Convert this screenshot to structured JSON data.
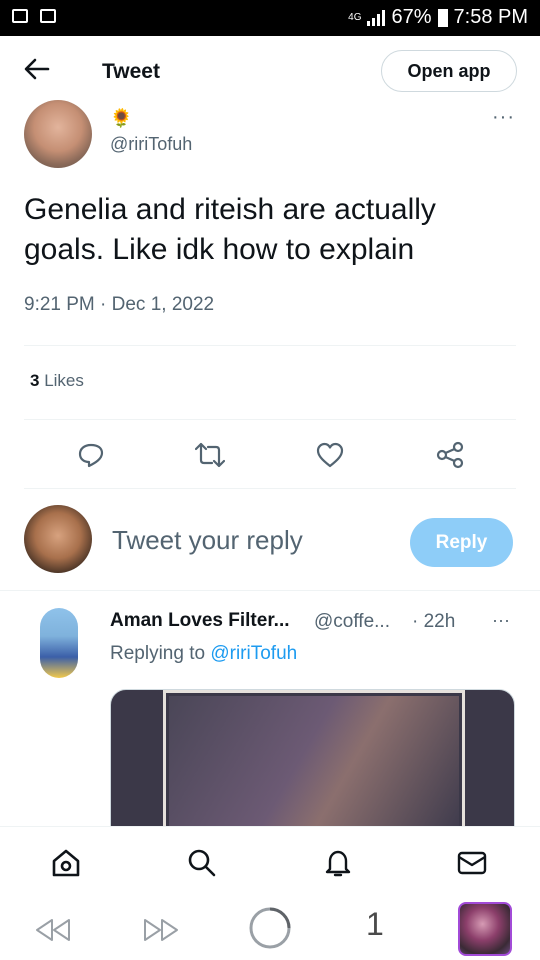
{
  "status_bar": {
    "network": "4G",
    "battery": "67%",
    "time": "7:58 PM"
  },
  "header": {
    "back_icon": "arrow-left-icon",
    "title": "Tweet",
    "open_app": "Open app"
  },
  "tweet": {
    "author_emoji": "🌻",
    "handle": "@ririTofuh",
    "text": "Genelia and riteish are actually goals. Like idk how to explain",
    "timestamp": "9:21 PM · Dec 1, 2022",
    "likes_count": "3",
    "likes_label": "Likes",
    "more_label": "···"
  },
  "actions": [
    {
      "icon": "reply-icon"
    },
    {
      "icon": "retweet-icon"
    },
    {
      "icon": "heart-icon"
    },
    {
      "icon": "share-icon"
    }
  ],
  "reply_box": {
    "placeholder": "Tweet your reply",
    "button": "Reply"
  },
  "reply": {
    "name": "Aman Loves Filter...",
    "handle": "@coffe...",
    "time": "· 22h",
    "more": "···",
    "replying_prefix": "Replying to",
    "replying_to": "@ririTofuh"
  },
  "bottom_nav": [
    {
      "icon": "home-icon"
    },
    {
      "icon": "search-icon"
    },
    {
      "icon": "notifications-icon"
    },
    {
      "icon": "messages-icon"
    }
  ],
  "system_bar": {
    "tab_count": "1"
  },
  "colors": {
    "accent": "#1d9bf0",
    "reply_button": "#8ecdf8",
    "muted_text": "#536471"
  }
}
